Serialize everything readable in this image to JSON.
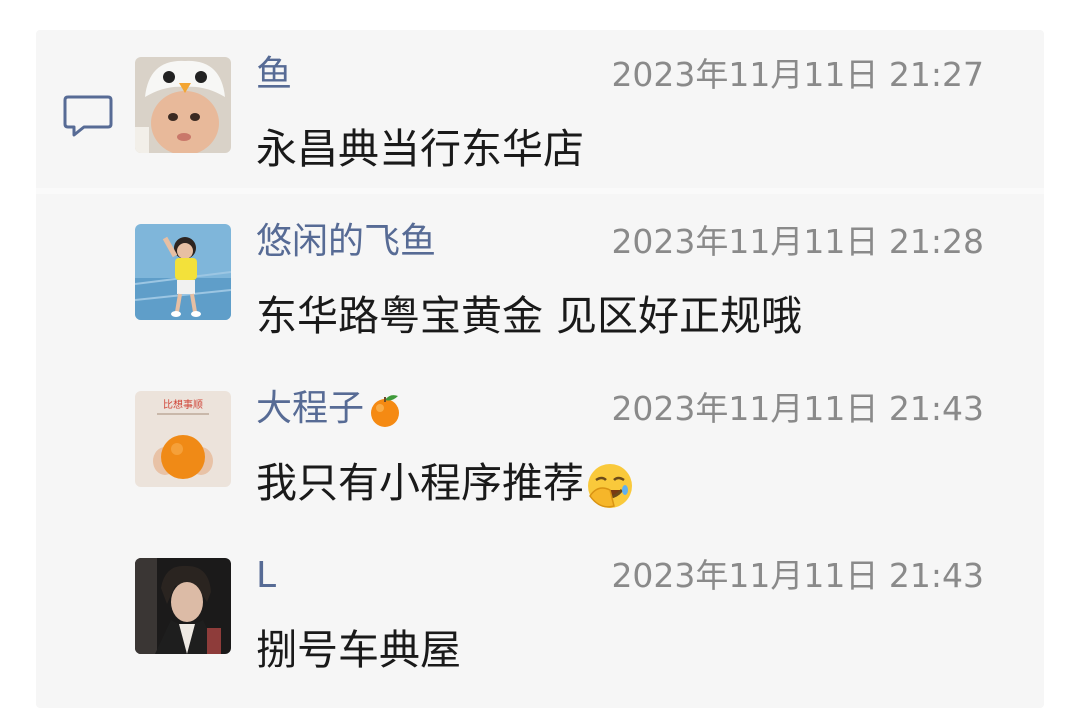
{
  "comments": [
    {
      "name": "鱼",
      "name_emoji": "",
      "time": "2023年11月11日 21:27",
      "text": "永昌典当行东华店",
      "text_emoji": "",
      "avatar_icon": "baby-chick-hat-avatar"
    },
    {
      "name": "悠闲的飞鱼",
      "name_emoji": "",
      "time": "2023年11月11日 21:28",
      "text": "东华路粤宝黄金 见区好正规哦",
      "text_emoji": "",
      "avatar_icon": "child-photo-avatar"
    },
    {
      "name": "大程子",
      "name_emoji": "orange-emoji",
      "time": "2023年11月11日 21:43",
      "text": "我只有小程序推荐",
      "text_emoji": "facepalm-emoji",
      "avatar_icon": "orange-poster-avatar",
      "avatar_caption": "比想事顺"
    },
    {
      "name": "L",
      "name_emoji": "",
      "time": "2023年11月11日 21:43",
      "text": "捌号车典屋",
      "text_emoji": "",
      "avatar_icon": "man-portrait-avatar"
    }
  ],
  "colors": {
    "panel_bg": "#f6f6f6",
    "name": "#576b95",
    "time": "#8a8a8a",
    "text": "#1a1a1a",
    "icon": "#576b95"
  }
}
